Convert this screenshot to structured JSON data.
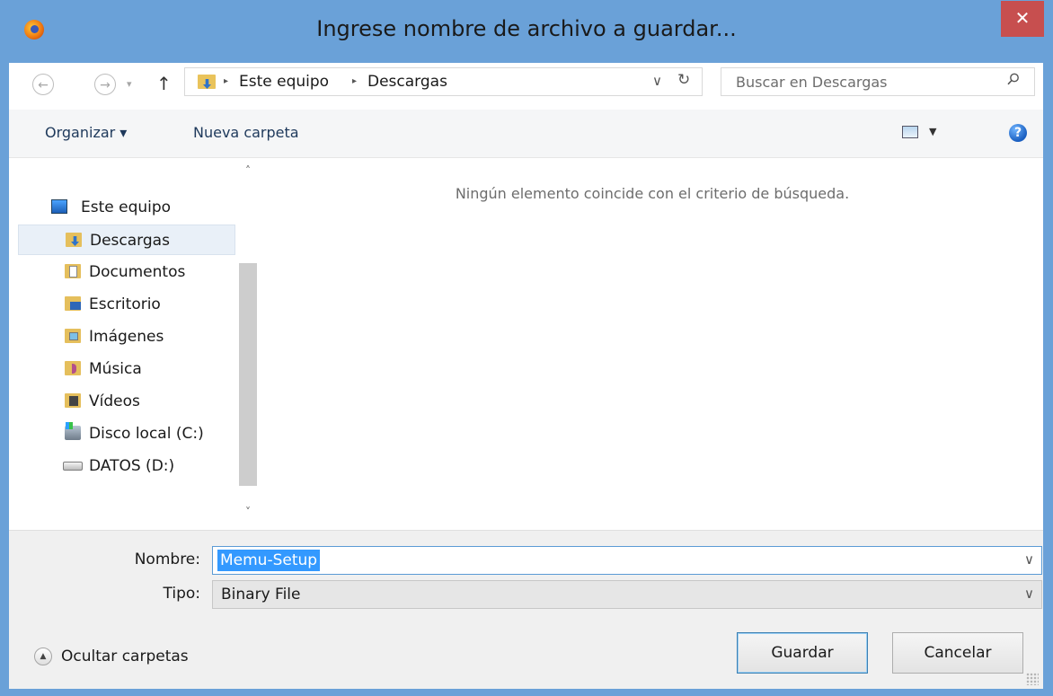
{
  "window": {
    "title": "Ingrese nombre de archivo a guardar...",
    "close_glyph": "✕",
    "app_icon": "firefox-icon"
  },
  "nav": {
    "back_glyph": "←",
    "forward_glyph": "→",
    "dropdown_glyph": "▾",
    "up_glyph": "↑",
    "breadcrumbs": [
      "Este equipo",
      "Descargas"
    ],
    "separator_glyph": "▸",
    "address_dropdown_glyph": "∨",
    "refresh_glyph": "↻",
    "search_placeholder": "Buscar en Descargas"
  },
  "toolbar": {
    "organize_label": "Organizar ▾",
    "new_folder_label": "Nueva carpeta",
    "view_dropdown_glyph": "▼",
    "help_glyph": "?"
  },
  "sidebar": {
    "root_label": "Este equipo",
    "items": [
      {
        "label": "Descargas",
        "icon": "downloads-folder-icon",
        "selected": true
      },
      {
        "label": "Documentos",
        "icon": "documents-folder-icon",
        "selected": false
      },
      {
        "label": "Escritorio",
        "icon": "desktop-folder-icon",
        "selected": false
      },
      {
        "label": "Imágenes",
        "icon": "pictures-folder-icon",
        "selected": false
      },
      {
        "label": "Música",
        "icon": "music-folder-icon",
        "selected": false
      },
      {
        "label": "Vídeos",
        "icon": "videos-folder-icon",
        "selected": false
      },
      {
        "label": "Disco local (C:)",
        "icon": "local-disk-icon",
        "selected": false
      },
      {
        "label": "DATOS (D:)",
        "icon": "drive-icon",
        "selected": false
      }
    ],
    "scroll_up_glyph": "˄",
    "scroll_down_glyph": "˅"
  },
  "content": {
    "empty_message": "Ningún elemento coincide con el criterio de búsqueda."
  },
  "form": {
    "name_label": "Nombre:",
    "name_value": "Memu-Setup",
    "type_label": "Tipo:",
    "type_value": "Binary File",
    "dropdown_glyph": "∨"
  },
  "footer": {
    "hide_folders_label": "Ocultar carpetas",
    "hide_folders_glyph": "▲",
    "save_label": "Guardar",
    "cancel_label": "Cancelar"
  },
  "colors": {
    "frame": "#6aa1d8",
    "close_button": "#c74f4f",
    "selection": "#3399ff"
  }
}
